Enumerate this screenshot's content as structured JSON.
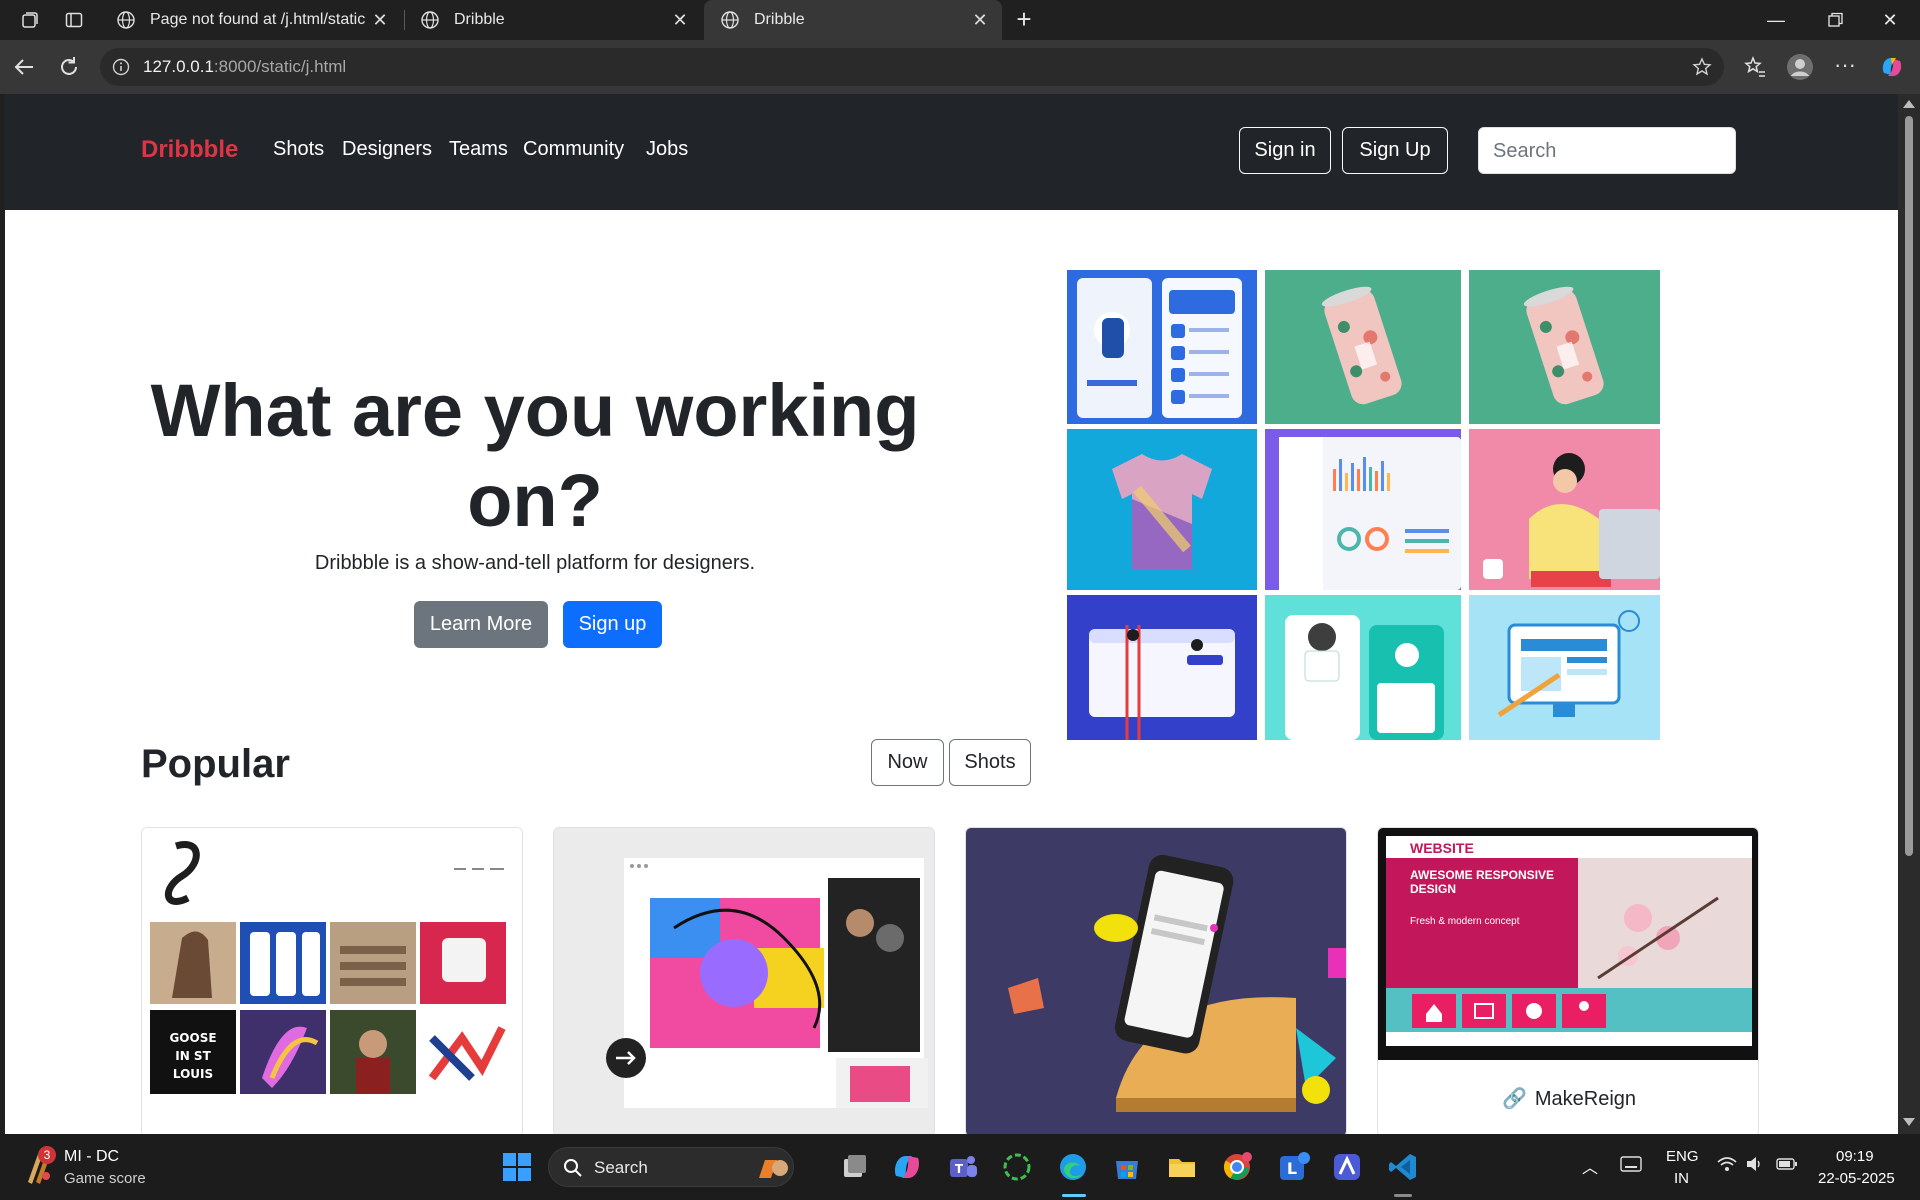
{
  "browser": {
    "tabs": [
      {
        "title": "Page not found at /j.html/static",
        "active": false
      },
      {
        "title": "Dribble",
        "active": false
      },
      {
        "title": "Dribble",
        "active": true
      }
    ],
    "url_host": "127.0.0.1",
    "url_rest": ":8000/static/j.html"
  },
  "site": {
    "brand": "Dribbble",
    "nav": [
      "Shots",
      "Designers",
      "Teams",
      "Community",
      "Jobs"
    ],
    "sign_in": "Sign in",
    "sign_up": "Sign Up",
    "search_placeholder": "Search",
    "hero": {
      "title": "What are you working on?",
      "subtitle": "Dribbble is a show-and-tell platform for designers.",
      "learn_more": "Learn More",
      "sign_up": "Sign up"
    },
    "popular": {
      "heading": "Popular",
      "filter_now": "Now",
      "filter_shots": "Shots"
    },
    "cards": [
      {
        "label": ""
      },
      {
        "label": ""
      },
      {
        "label": ""
      },
      {
        "label": "MakeReign",
        "banner_title": "WEBSITE",
        "banner_headline": "AWESOME RESPONSIVE DESIGN",
        "banner_sub": "Fresh & modern concept"
      }
    ],
    "card1_logo_text": "GOOSE IN ST LOUIS"
  },
  "taskbar": {
    "game_title": "MI - DC",
    "game_sub": "Game score",
    "game_badge": "3",
    "search_label": "Search",
    "lang_top": "ENG",
    "lang_bottom": "IN",
    "time": "09:19",
    "date": "22-05-2025"
  },
  "colors": {
    "brand": "#dc3545",
    "primary": "#0d6efd",
    "secondary": "#6c757d",
    "navbar": "#212529"
  }
}
